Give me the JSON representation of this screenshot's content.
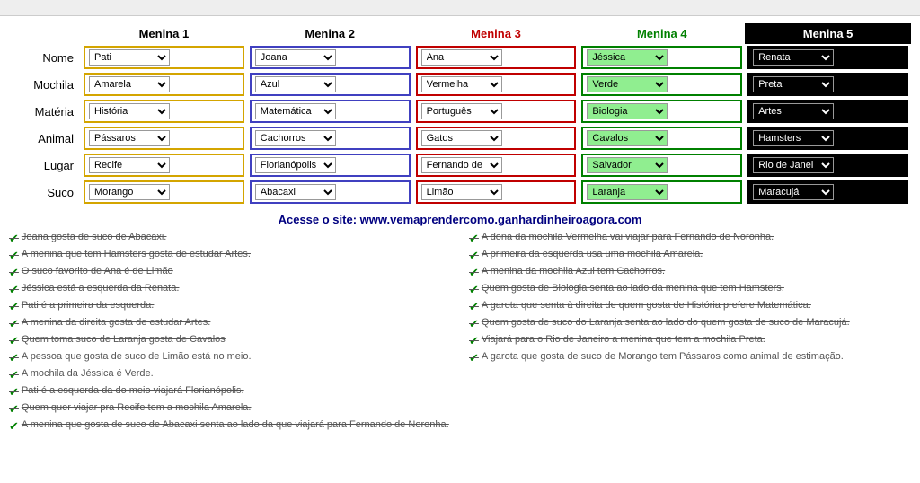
{
  "topbar": {},
  "puzzle": {
    "headers": [
      "",
      "Menina 1",
      "Menina 2",
      "Menina 3",
      "Menina 4",
      "Menina 5"
    ],
    "rows": [
      {
        "label": "Nome",
        "values": [
          "Pati",
          "Joana",
          "Ana",
          "Jéssica",
          "Renata"
        ]
      },
      {
        "label": "Mochila",
        "values": [
          "Amarela",
          "Azul",
          "Vermelha",
          "Verde",
          "Preta"
        ]
      },
      {
        "label": "Matéria",
        "values": [
          "História",
          "Matemática",
          "Português",
          "Biologia",
          "Artes"
        ]
      },
      {
        "label": "Animal",
        "values": [
          "Pássaros",
          "Cachorros",
          "Gatos",
          "Cavalos",
          "Hamsters"
        ]
      },
      {
        "label": "Lugar",
        "values": [
          "Recife",
          "Florianópolis",
          "Fernando de",
          "Salvador",
          "Rio de Janei"
        ]
      },
      {
        "label": "Suco",
        "values": [
          "Morango",
          "Abacaxi",
          "Limão",
          "Laranja",
          "Maracujá"
        ]
      }
    ]
  },
  "promo": {
    "text1": "Acesse o site:   ",
    "text2": "www.vemaprendercomo.ganhardinheiroagora.com"
  },
  "clues_left": [
    "Joana gosta de suco de Abacaxi.",
    "A menina que tem Hamsters gosta de estudar Artes.",
    "O suco favorito de Ana é de Limão",
    "Jéssica está a esquerda da Renata.",
    "Pati é a primeira da esquerda.",
    "A menina da direita gosta de estudar Artes.",
    "Quem toma suco de Laranja gosta de Cavalos",
    "A pessoa que gosta de suco de Limão está no meio.",
    "A mochila da Jéssica é Verde.",
    "Pati é a esquerda da do meio viajará Florianópolis.",
    "Quem quer viajar pra Recife tem a mochila Amarela.",
    "A menina que gosta de suco de Abacaxi senta ao lado da que viajará para Fernando de Noronha."
  ],
  "clues_right": [
    "A dona da mochila Vermelha vai viajar para Fernando de Noronha.",
    "A primeira da esquerda usa uma mochila Amarela.",
    "A menina da mochila Azul tem Cachorros.",
    "Quem gosta de Biologia senta ao lado da menina que tem Hamsters.",
    "A garota que senta à direita de quem gosta de História prefere Matemática.",
    "Quem gosta de suco do Laranja senta ao lado do quem gosta de suco de Maracujá.",
    "Viajará para o Rio de Janeiro a menina que tem a mochila Preta.",
    "A garota que gosta de suco de Morango tem Pássaros como animal de estimação."
  ]
}
